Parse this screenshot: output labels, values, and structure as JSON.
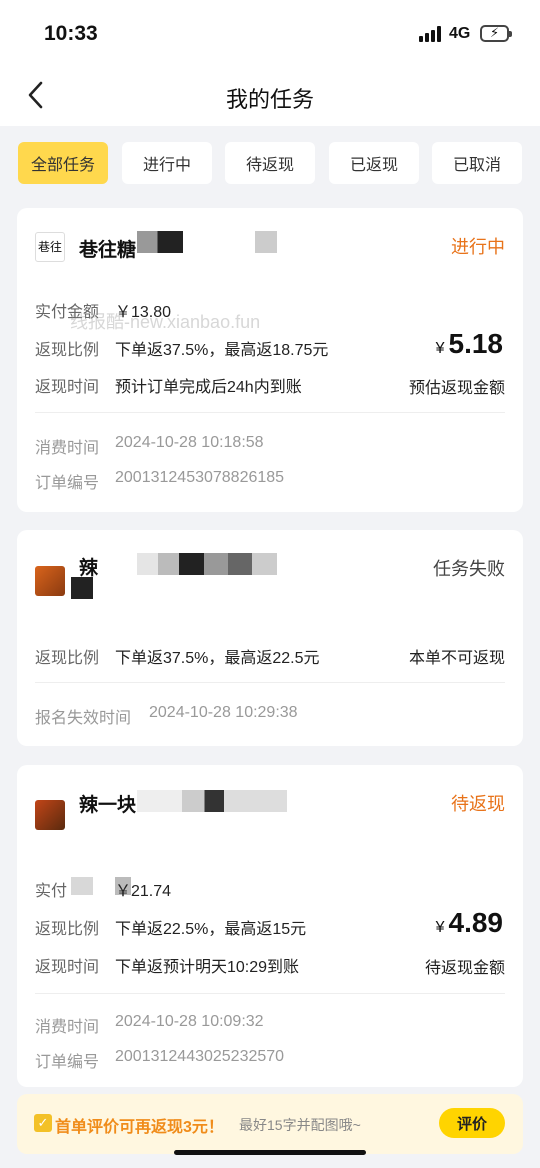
{
  "status_bar": {
    "time": "10:33",
    "network": "4G"
  },
  "header": {
    "title": "我的任务"
  },
  "tabs": [
    {
      "label": "全部任务",
      "active": true
    },
    {
      "label": "进行中",
      "active": false
    },
    {
      "label": "待返现",
      "active": false
    },
    {
      "label": "已返现",
      "active": false
    },
    {
      "label": "已取消",
      "active": false
    }
  ],
  "watermark": "线报酷-new.xianbao.fun",
  "orders": [
    {
      "shop_name": "巷往糖",
      "logo_text": "巷往",
      "status": "进行中",
      "status_color": "#e8731a",
      "paid_label": "实付金额",
      "paid_value": "￥13.80",
      "rate_label": "返现比例",
      "rate_value": "下单返37.5%，最高返18.75元",
      "time_label": "返现时间",
      "time_value": "预计订单完成后24h内到账",
      "currency": "¥",
      "amount": "5.18",
      "amount_note": "预估返现金额",
      "consume_label": "消费时间",
      "consume_value": "2024-10-28 10:18:58",
      "order_label": "订单编号",
      "order_value": "2001312453078826185"
    },
    {
      "shop_name": "辣",
      "status": "任务失败",
      "status_color": "#444444",
      "rate_label": "返现比例",
      "rate_value": "下单返37.5%，最高返22.5元",
      "note": "本单不可返现",
      "fail_label": "报名失效时间",
      "fail_value": "2024-10-28 10:29:38"
    },
    {
      "shop_name": "辣一块",
      "status": "待返现",
      "status_color": "#e8731a",
      "paid_label": "实付",
      "paid_value": "￥21.74",
      "rate_label": "返现比例",
      "rate_value": "下单返22.5%，最高返15元",
      "time_label": "返现时间",
      "time_value": "下单返预计明天10:29到账",
      "currency": "¥",
      "amount": "4.89",
      "amount_note": "待返现金额",
      "consume_label": "消费时间",
      "consume_value": "2024-10-28 10:09:32",
      "order_label": "订单编号",
      "order_value": "2001312443025232570"
    }
  ],
  "review_bar": {
    "main": "首单评价可再返现3元！",
    "sub": "最好15字并配图哦~",
    "button": "评价"
  }
}
